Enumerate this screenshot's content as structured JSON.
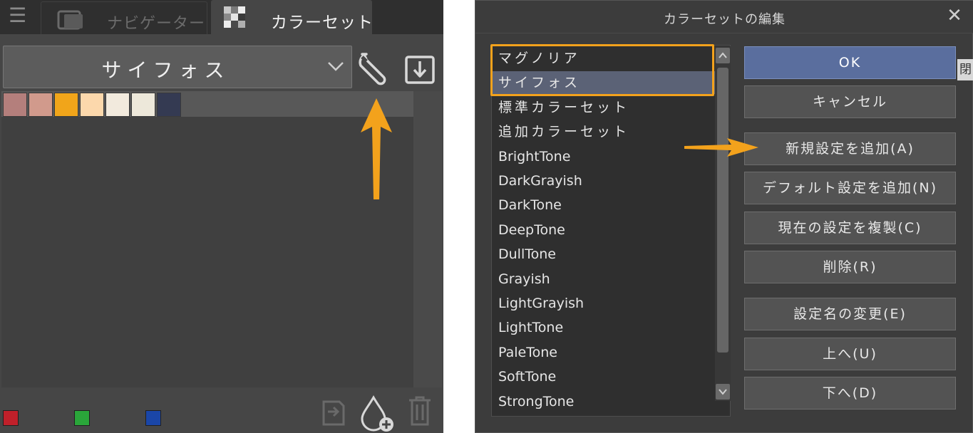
{
  "left_panel": {
    "tabs": [
      {
        "label": "ナビゲーター",
        "icon": "navigator-icon",
        "active": false
      },
      {
        "label": "カラーセット",
        "icon": "colorset-icon",
        "active": true
      }
    ],
    "colorset_dropdown": {
      "selected": "サイフォス"
    },
    "swatches": [
      "#b47f7c",
      "#d19a8c",
      "#f1a51a",
      "#fcd8ac",
      "#f2eadd",
      "#ede8da",
      "#343a52"
    ],
    "bottom_chips": [
      "#c0202a",
      "#2aa63a",
      "#1a46a8"
    ],
    "icons": {
      "settings": "wrench-icon",
      "import": "download-icon",
      "replace": "replace-color-icon",
      "add": "add-color-icon",
      "delete": "trash-icon"
    }
  },
  "dialog": {
    "title": "カラーセットの編集",
    "close_icon": "close-icon",
    "list_items": [
      "マグノリア",
      "サイフォス",
      "標準カラーセット",
      "追加カラーセット",
      "BrightTone",
      "DarkGrayish",
      "DarkTone",
      "DeepTone",
      "DullTone",
      "Grayish",
      "LightGrayish",
      "LightTone",
      "PaleTone",
      "SoftTone",
      "StrongTone"
    ],
    "selected_index": 1,
    "buttons": {
      "ok": "OK",
      "cancel": "キャンセル",
      "add_new": "新規設定を追加(A)",
      "add_default": "デフォルト設定を追加(N)",
      "duplicate": "現在の設定を複製(C)",
      "delete": "削除(R)",
      "rename": "設定名の変更(E)",
      "move_up": "上へ(U)",
      "move_down": "下へ(D)"
    },
    "edge_tab": "閉"
  },
  "annotation_color": "#f3a21c"
}
